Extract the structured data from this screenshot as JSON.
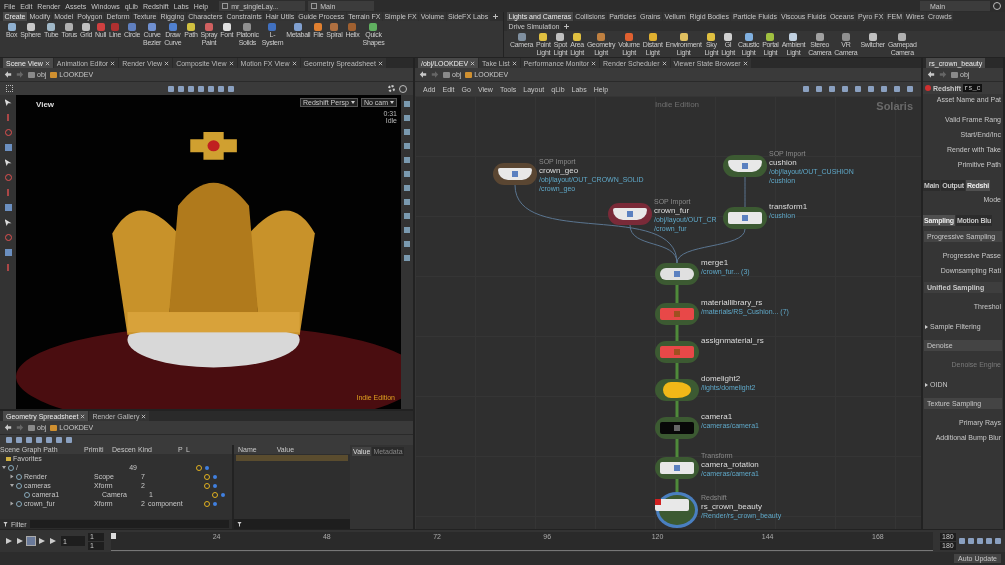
{
  "menu_bar": {
    "items": [
      "File",
      "Edit",
      "Render",
      "Assets",
      "Windows",
      "qLib",
      "Redshift",
      "Labs",
      "Help"
    ],
    "desktop": "mr_singleLay...",
    "desktop_context": "Main",
    "context": "Main"
  },
  "shelves": [
    {
      "tabs": [
        {
          "label": "Create",
          "selected": true
        },
        {
          "label": "Modify",
          "selected": false
        },
        {
          "label": "Model",
          "selected": false
        },
        {
          "label": "Polygon",
          "selected": false
        },
        {
          "label": "Deform",
          "selected": false
        },
        {
          "label": "Texture",
          "selected": false
        },
        {
          "label": "Rigging",
          "selected": false
        },
        {
          "label": "Characters",
          "selected": false
        },
        {
          "label": "Constraints",
          "selected": false
        },
        {
          "label": "Hair Utils",
          "selected": false
        },
        {
          "label": "Guide Process",
          "selected": false
        },
        {
          "label": "Terrain FX",
          "selected": false
        },
        {
          "label": "Simple FX",
          "selected": false
        },
        {
          "label": "Volume",
          "selected": false
        },
        {
          "label": "SideFX Labs",
          "selected": false
        }
      ],
      "tools": [
        {
          "label": "Box",
          "color": "#8fb0d0"
        },
        {
          "label": "Sphere",
          "color": "#c8c8c8"
        },
        {
          "label": "Tube",
          "color": "#a0b8c8"
        },
        {
          "label": "Torus",
          "color": "#b0b0b0"
        },
        {
          "label": "Grid",
          "color": "#c0c0c0"
        },
        {
          "label": "Null",
          "color": "#d04040"
        },
        {
          "label": "Line",
          "color": "#b03030"
        },
        {
          "label": "Circle",
          "color": "#6080c0"
        },
        {
          "label": "Curve Bezier",
          "color": "#7090d0"
        },
        {
          "label": "Draw Curve",
          "color": "#5080d0"
        },
        {
          "label": "Path",
          "color": "#d0c040"
        },
        {
          "label": "Spray Paint",
          "color": "#d06060"
        },
        {
          "label": "Font",
          "color": "#e0e0e0"
        },
        {
          "label": "Platonic Solids",
          "color": "#909090"
        },
        {
          "label": "L-System",
          "color": "#4070c0"
        },
        {
          "label": "Metaball",
          "color": "#80a0d0"
        },
        {
          "label": "File",
          "color": "#e08030"
        },
        {
          "label": "Spiral",
          "color": "#b07040"
        },
        {
          "label": "Helix",
          "color": "#a06030"
        },
        {
          "label": "Quick Shapes",
          "color": "#60b060"
        }
      ]
    },
    {
      "tabs": [
        {
          "label": "Lights and Cameras",
          "selected": true
        },
        {
          "label": "Collisions",
          "selected": false
        },
        {
          "label": "Particles",
          "selected": false
        },
        {
          "label": "Grains",
          "selected": false
        },
        {
          "label": "Vellum",
          "selected": false
        },
        {
          "label": "Rigid Bodies",
          "selected": false
        },
        {
          "label": "Particle Fluids",
          "selected": false
        },
        {
          "label": "Viscous Fluids",
          "selected": false
        },
        {
          "label": "Oceans",
          "selected": false
        },
        {
          "label": "Pyro FX",
          "selected": false
        },
        {
          "label": "FEM",
          "selected": false
        },
        {
          "label": "Wires",
          "selected": false
        },
        {
          "label": "Crowds",
          "selected": false
        },
        {
          "label": "Drive Simulation",
          "selected": false
        }
      ],
      "tools": [
        {
          "label": "Camera",
          "color": "#8090a0"
        },
        {
          "label": "Point Light",
          "color": "#e0c040"
        },
        {
          "label": "Spot Light",
          "color": "#c0c0c0"
        },
        {
          "label": "Area Light",
          "color": "#e0c040"
        },
        {
          "label": "Geometry Light",
          "color": "#c08040"
        },
        {
          "label": "Volume Light",
          "color": "#e06030"
        },
        {
          "label": "Distant Light",
          "color": "#e0b030"
        },
        {
          "label": "Environment Light",
          "color": "#e0c060"
        },
        {
          "label": "Sky Light",
          "color": "#e0c040"
        },
        {
          "label": "GI Light",
          "color": "#d0d0d0"
        },
        {
          "label": "Caustic Light",
          "color": "#80b0e0"
        },
        {
          "label": "Portal Light",
          "color": "#a0c040"
        },
        {
          "label": "Ambient Light",
          "color": "#c0d0e0"
        },
        {
          "label": "Stereo Camera",
          "color": "#a0a0a0"
        },
        {
          "label": "VR Camera",
          "color": "#909090"
        },
        {
          "label": "Switcher",
          "color": "#c0c0c0"
        },
        {
          "label": "Gamepad Camera",
          "color": "#b0b0b0"
        }
      ]
    }
  ],
  "scene_view": {
    "tabs": [
      {
        "label": "Scene View",
        "selected": true
      },
      {
        "label": "Animation Editor",
        "selected": false
      },
      {
        "label": "Render View",
        "selected": false
      },
      {
        "label": "Composite View",
        "selected": false
      },
      {
        "label": "Motion FX View",
        "selected": false
      },
      {
        "label": "Geometry Spreadsheet",
        "selected": false
      }
    ],
    "path": [
      "obj",
      "LOOKDEV"
    ],
    "viewport": {
      "title": "View",
      "camera_menu": "Redshift Persp",
      "cam_menu": "No cam",
      "time": "0:31",
      "status": "Idle",
      "edition": "Indie Edition"
    }
  },
  "spreadsheet": {
    "tabs": [
      {
        "label": "Geometry Spreadsheet",
        "selected": true
      },
      {
        "label": "Render Gallery",
        "selected": false
      }
    ],
    "path": [
      "obj",
      "LOOKDEV"
    ],
    "columns": [
      "Scene Graph Path",
      "Primiti",
      "Descen",
      "Kind",
      "P",
      "L"
    ],
    "favorites": "Favorites",
    "tree": [
      {
        "label": "/",
        "descendants": "49",
        "expanded": true,
        "children": [
          {
            "label": "Render",
            "type": "Scope",
            "descendants": "7",
            "expanded": false
          },
          {
            "label": "cameras",
            "type": "Xform",
            "descendants": "2",
            "expanded": true,
            "children": [
              {
                "label": "camera1",
                "type": "Camera",
                "descendants": "1"
              }
            ]
          },
          {
            "label": "crown_fur",
            "type": "Xform",
            "descendants": "2",
            "model_kind": "component",
            "expanded": false
          }
        ]
      }
    ],
    "attr_columns": [
      "Name",
      "Value"
    ],
    "side_tabs": [
      {
        "label": "Value",
        "selected": true
      },
      {
        "label": "Metadata",
        "selected": false
      }
    ],
    "filter": "Filter"
  },
  "network": {
    "tabs": [
      {
        "label": "/obj/LOOKDEV",
        "selected": true
      },
      {
        "label": "Take List",
        "selected": false
      },
      {
        "label": "Performance Monitor",
        "selected": false
      },
      {
        "label": "Render Scheduler",
        "selected": false
      },
      {
        "label": "Viewer State Browser",
        "selected": false
      }
    ],
    "path": [
      "obj",
      "LOOKDEV"
    ],
    "menu": [
      "Add",
      "Edit",
      "Go",
      "View",
      "Tools",
      "Layout",
      "qLib",
      "Labs",
      "Help"
    ],
    "edition": "Indie Edition",
    "context": "Solaris",
    "nodes": [
      {
        "kind": "sop_import",
        "color": "#5a4632",
        "type_label": "SOP Import",
        "name": "crown_geo",
        "paths": [
          "/obj/layout/OUT_CROWN_SOLID",
          "/crown_geo"
        ],
        "selected": false
      },
      {
        "kind": "sop_import",
        "color": "#7a2a38",
        "type_label": "SOP Import",
        "name": "crown_fur",
        "paths": [
          "/obj/layout/OUT_CR",
          "/crown_fur"
        ],
        "selected": false
      },
      {
        "kind": "sop_import",
        "color": "#3c5a32",
        "type_label": "SOP Import",
        "name": "cushion",
        "paths": [
          "/obj/layout/OUT_CUSHION",
          "/cushion"
        ],
        "selected": false
      },
      {
        "kind": "transform",
        "color": "#3c5a32",
        "name": "transform1",
        "paths": [
          "/cushion"
        ],
        "selected": false
      },
      {
        "kind": "merge",
        "color": "#3c5a32",
        "name": "merge1",
        "paths": [
          "/crown_fur... (3)"
        ],
        "selected": false
      },
      {
        "kind": "material",
        "color": "#3c5a32",
        "name": "materiallibrary_rs",
        "paths": [
          "/materials/RS_Cushion... (7)"
        ],
        "selected": false
      },
      {
        "kind": "material",
        "color": "#3c5a32",
        "name": "assignmaterial_rs",
        "selected": false
      },
      {
        "kind": "light",
        "color": "#3c5a32",
        "name": "domelight2",
        "paths": [
          "/lights/domelight2"
        ],
        "selected": false
      },
      {
        "kind": "camera",
        "color": "#3c5a32",
        "name": "camera1",
        "paths": [
          "/cameras/camera1"
        ],
        "selected": false
      },
      {
        "kind": "transform",
        "color": "#3c5a32",
        "type_label": "Transform",
        "name": "camera_rotation",
        "paths": [
          "/cameras/camera1"
        ],
        "selected": false
      },
      {
        "kind": "render",
        "color": "#3c5a32",
        "type_label": "Redshift",
        "name": "rs_crown_beauty",
        "paths": [
          "/Render/rs_crown_beauty"
        ],
        "selected": true
      }
    ]
  },
  "parameters": {
    "tab": "rs_crown_beauty",
    "path": [
      "obj"
    ],
    "node_type": "Redshift",
    "node_name": "rs_c",
    "rows": [
      {
        "kind": "header",
        "text": "Asset Name and Pat"
      },
      {
        "kind": "label",
        "text": "Valid Frame Rang",
        "disabled": false
      },
      {
        "kind": "label",
        "text": "Start/End/Inc",
        "disabled": false
      },
      {
        "kind": "label",
        "text": "Render with Take",
        "disabled": false
      },
      {
        "kind": "label",
        "text": "Primitive Path",
        "disabled": false
      },
      {
        "kind": "tabs",
        "tabs": [
          {
            "label": "Main",
            "selected": false
          },
          {
            "label": "Output",
            "selected": false
          },
          {
            "label": "Redshi",
            "selected": true
          }
        ]
      },
      {
        "kind": "label",
        "text": "Mode",
        "disabled": false
      },
      {
        "kind": "tabs",
        "tabs": [
          {
            "label": "Sampling",
            "selected": true
          },
          {
            "label": "Motion Blu",
            "selected": false
          }
        ]
      },
      {
        "kind": "section",
        "text": "Progressive Sampling"
      },
      {
        "kind": "label",
        "text": "Progressive Passe",
        "disabled": false
      },
      {
        "kind": "label",
        "text": "Downsampling Rati",
        "disabled": false
      },
      {
        "kind": "heading",
        "text": "Unified Sampling"
      },
      {
        "kind": "label",
        "text": "Threshol",
        "disabled": false
      },
      {
        "kind": "folder",
        "text": "Sample Filtering",
        "expanded": false
      },
      {
        "kind": "section",
        "text": "Denoise"
      },
      {
        "kind": "label",
        "text": "Denoise Engine",
        "disabled": true
      },
      {
        "kind": "folder",
        "text": "OIDN",
        "expanded": false
      },
      {
        "kind": "section",
        "text": "Texture Sampling"
      },
      {
        "kind": "label",
        "text": "Primary Rays",
        "disabled": false
      },
      {
        "kind": "label",
        "text": "Additional Bump Blur",
        "disabled": false
      }
    ]
  },
  "timeline": {
    "frame": "1",
    "start": "1",
    "start_step": "1",
    "ticks": [
      "24",
      "48",
      "72",
      "96",
      "120",
      "144",
      "168"
    ],
    "end": "180",
    "end_step": "180",
    "auto_update": "Auto Update"
  }
}
